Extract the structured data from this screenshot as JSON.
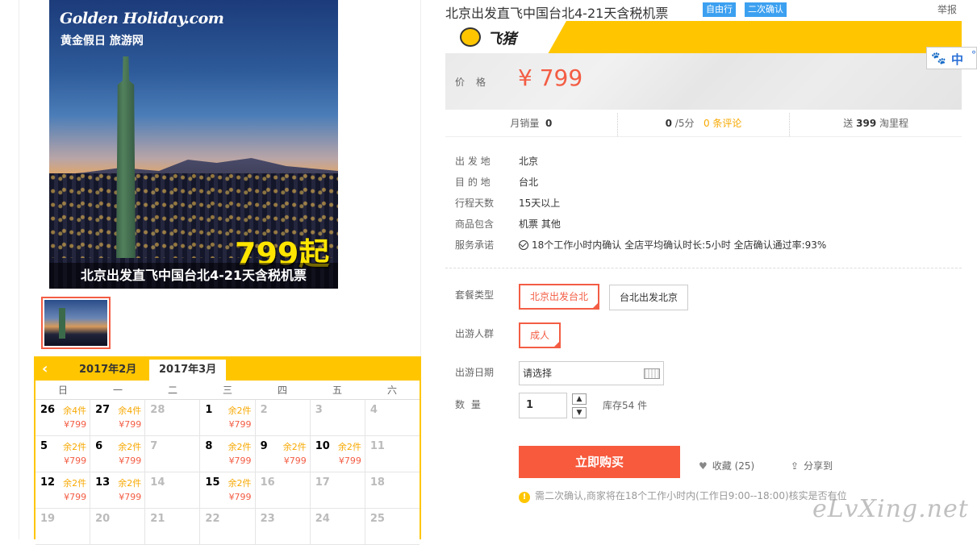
{
  "hero": {
    "brand": "Golden Holiday.com",
    "brand_cn": "黄金假日 旅游网",
    "price_tag": "799起",
    "caption": "北京出发直飞中国台北4-21天含税机票"
  },
  "calendar": {
    "prev_icon": "chevron-left-icon",
    "tabs": [
      "2017年2月",
      "2017年3月"
    ],
    "weekdays": [
      "日",
      "一",
      "二",
      "三",
      "四",
      "五",
      "六"
    ],
    "rows": [
      [
        {
          "d": "26",
          "rem": "余4件",
          "pr": "¥799"
        },
        {
          "d": "27",
          "rem": "余4件",
          "pr": "¥799"
        },
        {
          "d": "28",
          "off": true
        },
        {
          "d": "1",
          "rem": "余2件",
          "pr": "¥799"
        },
        {
          "d": "2",
          "off": true
        },
        {
          "d": "3",
          "off": true
        },
        {
          "d": "4",
          "off": true
        }
      ],
      [
        {
          "d": "5",
          "rem": "余2件",
          "pr": "¥799"
        },
        {
          "d": "6",
          "rem": "余2件",
          "pr": "¥799"
        },
        {
          "d": "7",
          "off": true
        },
        {
          "d": "8",
          "rem": "余2件",
          "pr": "¥799"
        },
        {
          "d": "9",
          "rem": "余2件",
          "pr": "¥799"
        },
        {
          "d": "10",
          "rem": "余2件",
          "pr": "¥799"
        },
        {
          "d": "11",
          "off": true
        }
      ],
      [
        {
          "d": "12",
          "rem": "余2件",
          "pr": "¥799"
        },
        {
          "d": "13",
          "rem": "余2件",
          "pr": "¥799"
        },
        {
          "d": "14",
          "off": true
        },
        {
          "d": "15",
          "rem": "余2件",
          "pr": "¥799"
        },
        {
          "d": "16",
          "off": true
        },
        {
          "d": "17",
          "off": true
        },
        {
          "d": "18",
          "off": true
        }
      ],
      [
        {
          "d": "19",
          "off": true
        },
        {
          "d": "20",
          "off": true
        },
        {
          "d": "21",
          "off": true
        },
        {
          "d": "22",
          "off": true
        },
        {
          "d": "23",
          "off": true
        },
        {
          "d": "24",
          "off": true
        },
        {
          "d": "25",
          "off": true
        }
      ]
    ]
  },
  "product": {
    "title": "北京出发直飞中国台北4-21天含税机票",
    "tag1": "自由行",
    "tag2": "二次确认",
    "report": "举报",
    "brand_name": "飞猪",
    "price_label": "价格",
    "price": "¥ 799"
  },
  "search_widget": {
    "zh": "中",
    "paw_icon": "paw-icon"
  },
  "stats": {
    "monthly_label": "月销量",
    "monthly_value": "0",
    "rating_value": "0",
    "rating_suffix": "/5分",
    "reviews": "0 条评论",
    "mileage_prefix": "送",
    "mileage_value": "399",
    "mileage_suffix": "淘里程"
  },
  "info": [
    {
      "k": "出 发 地",
      "v": "北京"
    },
    {
      "k": "目 的 地",
      "v": "台北"
    },
    {
      "k": "行程天数",
      "v": "15天以上"
    },
    {
      "k": "商品包含",
      "v": "机票  其他"
    },
    {
      "k": "服务承诺",
      "v": "18个工作小时内确认    全店平均确认时长:5小时    全店确认通过率:93%"
    }
  ],
  "options": {
    "package_label": "套餐类型",
    "package_selected": "北京出发台北",
    "package_other": "台北出发北京",
    "group_label": "出游人群",
    "group_selected": "成人",
    "date_label": "出游日期",
    "date_placeholder": "请选择",
    "qty_label": "数    量",
    "qty_value": "1",
    "qty_up": "▲",
    "qty_down": "▼",
    "stock": "库存54 件"
  },
  "actions": {
    "buy": "立即购买",
    "fav": "收藏 (25)",
    "share": "分享到",
    "notice": "需二次确认,商家将在18个工作小时内(工作日9:00--18:00)核实是否有位"
  },
  "watermark": "eLvXing.net"
}
